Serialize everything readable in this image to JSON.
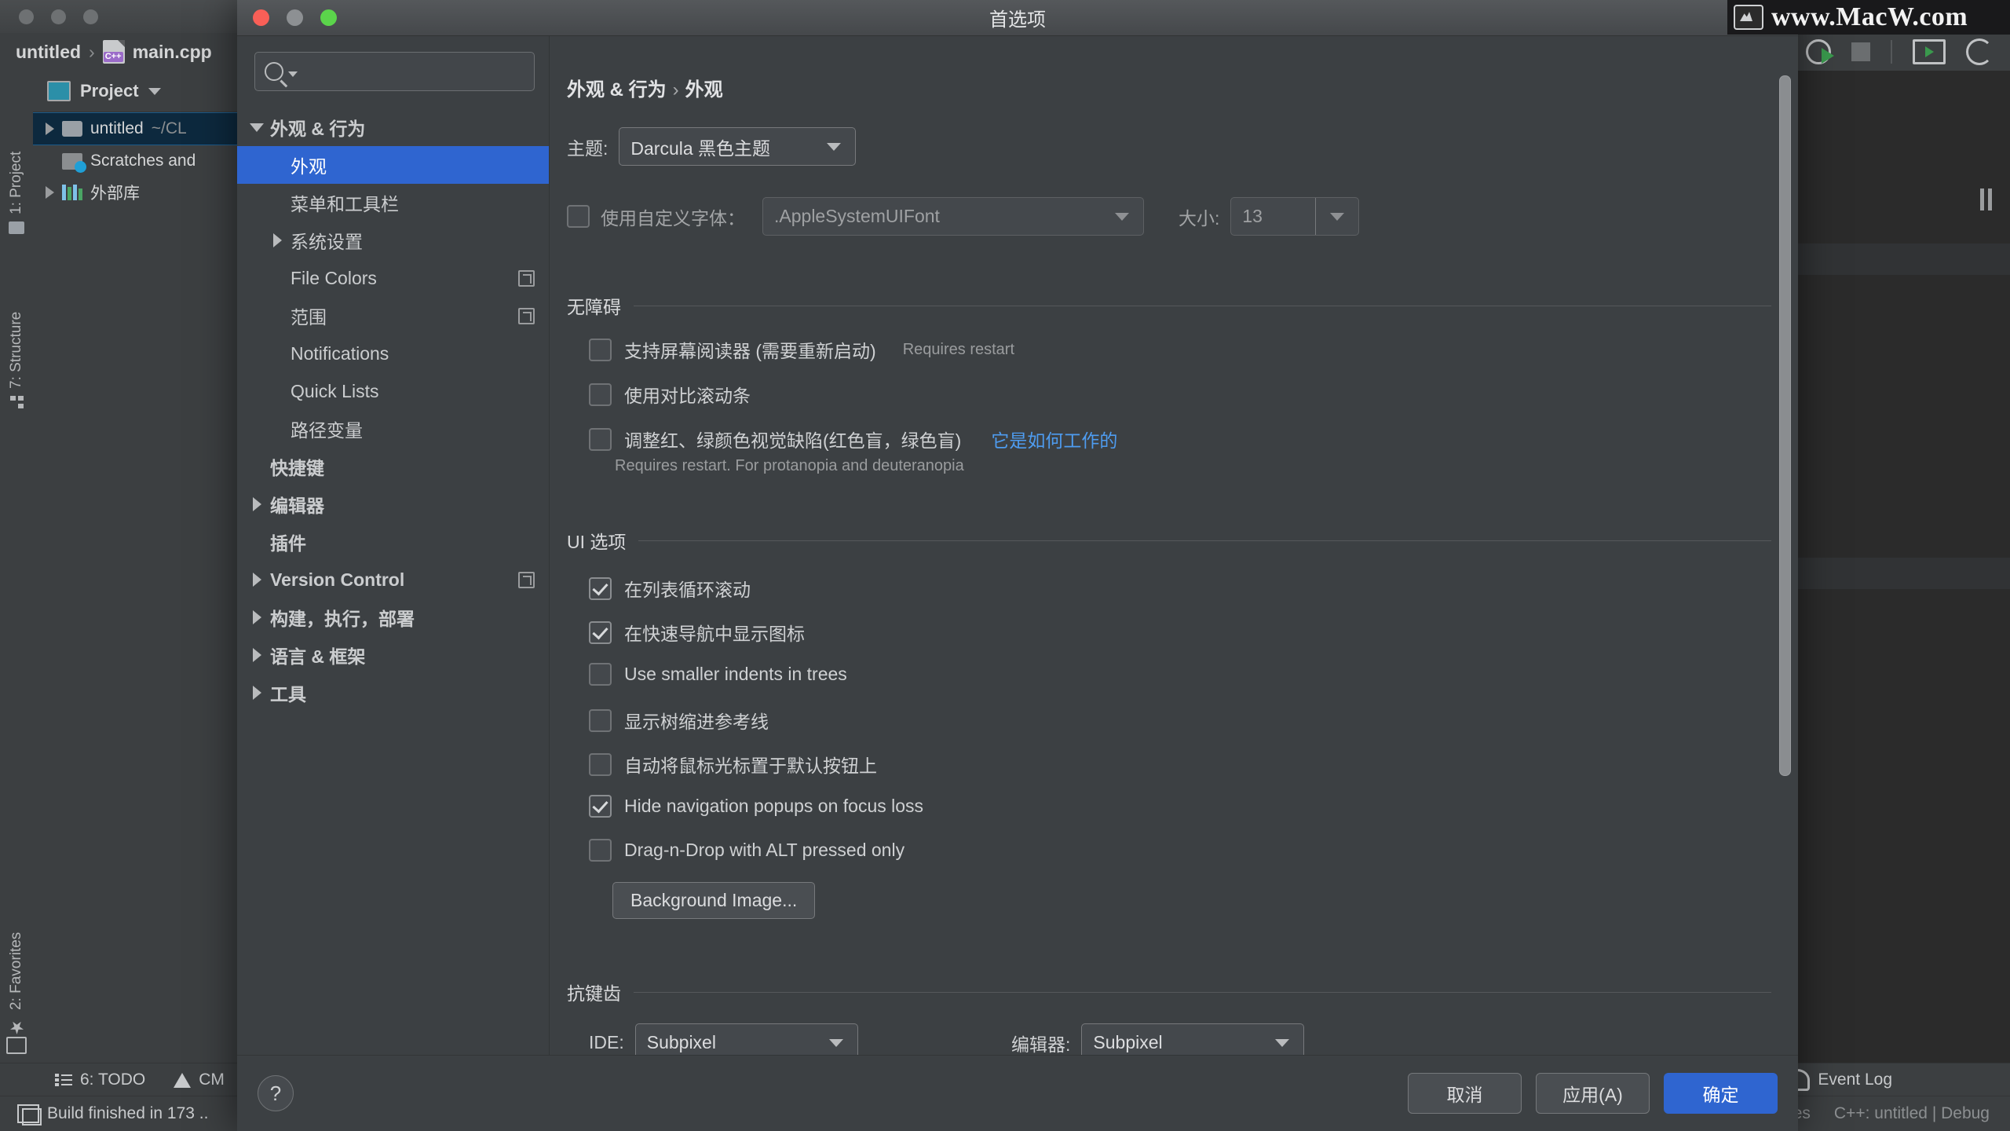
{
  "ide": {
    "navbar": {
      "project": "untitled",
      "separator": "›",
      "file": "main.cpp",
      "file_icon": "cpp-file-icon"
    },
    "project_panel": {
      "title": "Project",
      "rows": [
        {
          "label": "untitled",
          "detail": "~/CL",
          "icon": "folder-icon",
          "expandable": true,
          "selected": true
        },
        {
          "label": "Scratches and",
          "detail": "",
          "icon": "scratches-icon",
          "expandable": false,
          "selected": false
        },
        {
          "label": "外部库",
          "detail": "",
          "icon": "external-libraries-icon",
          "expandable": true,
          "selected": false
        }
      ]
    },
    "left_tool_tabs": [
      {
        "label": "1: Project",
        "icon": "folder-icon"
      },
      {
        "label": "7: Structure",
        "icon": "structure-icon"
      },
      {
        "label": "2: Favorites",
        "icon": "star-icon"
      }
    ],
    "status_row": {
      "todo": "6: TODO",
      "cmake": "CM",
      "event_log": "Event Log"
    },
    "status_bar": {
      "build": "Build finished in 173 ..",
      "right_left": "es",
      "right": "C++: untitled | Debug"
    },
    "watermark": "www.MacW.com"
  },
  "dialog": {
    "title": "首选项",
    "window_controls": {
      "close": "close-button",
      "minimize": "minimize-button",
      "zoom": "zoom-button"
    },
    "search": {
      "value": "",
      "placeholder": ""
    },
    "tree": [
      {
        "label": "外观 & 行为",
        "level": 1,
        "expander": "down",
        "bold": true,
        "selected": false,
        "copy": false
      },
      {
        "label": "外观",
        "level": 2,
        "expander": "none",
        "bold": false,
        "selected": true,
        "copy": false
      },
      {
        "label": "菜单和工具栏",
        "level": 2,
        "expander": "none",
        "bold": false,
        "selected": false,
        "copy": false
      },
      {
        "label": "系统设置",
        "level": 2,
        "expander": "right",
        "bold": false,
        "selected": false,
        "copy": false
      },
      {
        "label": "File Colors",
        "level": 2,
        "expander": "none",
        "bold": false,
        "selected": false,
        "copy": true
      },
      {
        "label": "范围",
        "level": 2,
        "expander": "none",
        "bold": false,
        "selected": false,
        "copy": true
      },
      {
        "label": "Notifications",
        "level": 2,
        "expander": "none",
        "bold": false,
        "selected": false,
        "copy": false
      },
      {
        "label": "Quick Lists",
        "level": 2,
        "expander": "none",
        "bold": false,
        "selected": false,
        "copy": false
      },
      {
        "label": "路径变量",
        "level": 2,
        "expander": "none",
        "bold": false,
        "selected": false,
        "copy": false
      },
      {
        "label": "快捷键",
        "level": 1,
        "expander": "none",
        "bold": true,
        "selected": false,
        "copy": false
      },
      {
        "label": "编辑器",
        "level": 1,
        "expander": "right",
        "bold": true,
        "selected": false,
        "copy": false
      },
      {
        "label": "插件",
        "level": 1,
        "expander": "none",
        "bold": true,
        "selected": false,
        "copy": false
      },
      {
        "label": "Version Control",
        "level": 1,
        "expander": "right",
        "bold": true,
        "selected": false,
        "copy": true
      },
      {
        "label": "构建，执行，部署",
        "level": 1,
        "expander": "right",
        "bold": true,
        "selected": false,
        "copy": false
      },
      {
        "label": "语言 & 框架",
        "level": 1,
        "expander": "right",
        "bold": true,
        "selected": false,
        "copy": false
      },
      {
        "label": "工具",
        "level": 1,
        "expander": "right",
        "bold": true,
        "selected": false,
        "copy": false
      }
    ],
    "breadcrumb": {
      "parent": "外观 & 行为",
      "sep": "›",
      "current": "外观"
    },
    "theme": {
      "label": "主题:",
      "value": "Darcula 黑色主题"
    },
    "custom_font": {
      "checkbox_label": "使用自定义字体：",
      "checked": false,
      "font_value": ".AppleSystemUIFont",
      "size_label": "大小:",
      "size_value": "13"
    },
    "accessibility": {
      "title": "无障碍",
      "items": [
        {
          "label": "支持屏幕阅读器 (需要重新启动)",
          "checked": false,
          "hint": "Requires restart",
          "link": ""
        },
        {
          "label": "使用对比滚动条",
          "checked": false,
          "hint": "",
          "link": ""
        },
        {
          "label": "调整红、绿颜色视觉缺陷(红色盲，绿色盲)",
          "checked": false,
          "hint": "",
          "link": "它是如何工作的"
        }
      ],
      "footnote": "Requires restart. For protanopia and deuteranopia"
    },
    "ui_options": {
      "title": "UI 选项",
      "items": [
        {
          "label": "在列表循环滚动",
          "checked": true
        },
        {
          "label": "在快速导航中显示图标",
          "checked": true
        },
        {
          "label": "Use smaller indents in trees",
          "checked": false
        },
        {
          "label": "显示树缩进参考线",
          "checked": false
        },
        {
          "label": "自动将鼠标光标置于默认按钮上",
          "checked": false
        },
        {
          "label": "Hide navigation popups on focus loss",
          "checked": true
        },
        {
          "label": "Drag-n-Drop with ALT pressed only",
          "checked": false
        }
      ],
      "background_image_button": "Background Image..."
    },
    "antialiasing": {
      "title": "抗键齿",
      "ide_label": "IDE:",
      "ide_value": "Subpixel",
      "editor_label": "编辑器:",
      "editor_value": "Subpixel"
    },
    "footer": {
      "help": "?",
      "cancel": "取消",
      "apply": "应用(A)",
      "ok": "确定"
    }
  },
  "colors": {
    "accent": "#2f65d0",
    "dialog_bg": "#3c4043",
    "ide_bg": "#3c3f41",
    "editor_bg": "#2b2b2b",
    "link": "#4e9cf0",
    "selection_tree": "#0d293e"
  }
}
